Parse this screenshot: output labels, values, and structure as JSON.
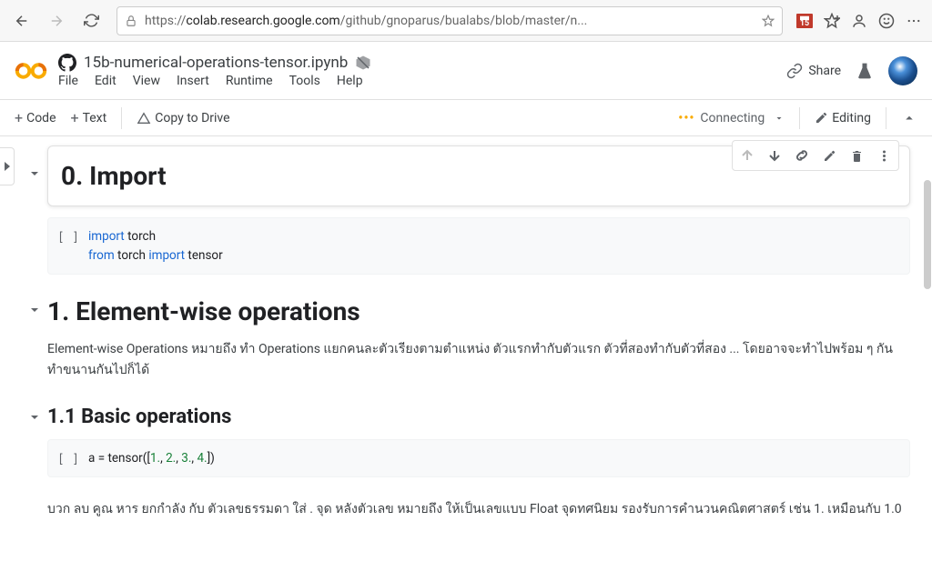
{
  "browser": {
    "url_prefix": "https://",
    "url_host": "colab.research.google.com",
    "url_path": "/github/gnoparus/bualabs/blob/master/n...",
    "calendar_badge": "15"
  },
  "header": {
    "filename": "15b-numerical-operations-tensor.ipynb",
    "menus": [
      "File",
      "Edit",
      "View",
      "Insert",
      "Runtime",
      "Tools",
      "Help"
    ],
    "share": "Share"
  },
  "toolbar": {
    "code": "Code",
    "text": "Text",
    "copy": "Copy to Drive",
    "status": "Connecting",
    "editing": "Editing"
  },
  "cells": {
    "h0": "0. Import",
    "code0_kw1": "import",
    "code0_t1": " torch",
    "code0_kw2": "from",
    "code0_t2": " torch ",
    "code0_kw3": "import",
    "code0_t3": " tensor",
    "h1": "1. Element-wise operations",
    "para1": "Element-wise Operations หมายถึง ทำ Operations แยกคนละตัวเรียงตามตำแหน่ง ตัวแรกทำกับตัวแรก ตัวที่สองทำกับตัวที่สอง ... โดยอาจจะทำไปพร้อม ๆ กัน ทำขนานกันไปก็ได้",
    "h11": "1.1 Basic operations",
    "code1_a": "a = tensor([",
    "code1_n1": "1.",
    "code1_c": ", ",
    "code1_n2": "2.",
    "code1_n3": "3.",
    "code1_n4": "4.",
    "code1_b": "])",
    "para2": "บวก ลบ คูณ หาร ยกกำลัง กับ ตัวเลขธรรมดา ใส่ . จุด หลังตัวเลข หมายถึง ให้เป็นเลขแบบ Float จุดทศนิยม รองรับการคำนวนคณิตศาสตร์ เช่น 1. เหมือนกับ 1.0",
    "gutter": "[ ]"
  }
}
